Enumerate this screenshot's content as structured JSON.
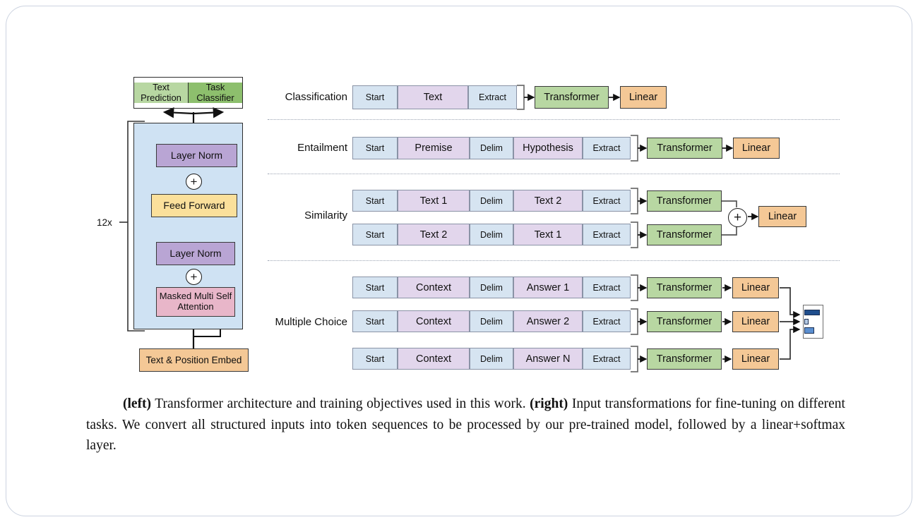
{
  "figure": {
    "left_panel": {
      "heads": [
        {
          "label": "Text Prediction",
          "color": "#b8d7a2"
        },
        {
          "label": "Task Classifier",
          "color": "#8dbf6d"
        }
      ],
      "repeat_label": "12x",
      "blocks": [
        {
          "name": "layer-norm-top",
          "label": "Layer Norm",
          "color": "#b9a5d4"
        },
        {
          "name": "feed-forward",
          "label": "Feed Forward",
          "color": "#fbe09b"
        },
        {
          "name": "layer-norm-bottom",
          "label": "Layer Norm",
          "color": "#b9a5d4"
        },
        {
          "name": "masked-multi-self-attention",
          "label": "Masked Multi Self Attention",
          "color": "#e8b6c9"
        }
      ],
      "embedding": {
        "label": "Text & Position Embed",
        "color": "#f4c896"
      },
      "block_background_color": "#cfe2f3",
      "add_symbol": "+"
    },
    "right_panel": {
      "transformer_label": "Transformer",
      "linear_label": "Linear",
      "add_symbol": "+",
      "tasks": [
        {
          "name": "classification",
          "label": "Classification",
          "sequences": [
            {
              "tokens": [
                "Start",
                "Text",
                "Extract"
              ]
            }
          ]
        },
        {
          "name": "entailment",
          "label": "Entailment",
          "sequences": [
            {
              "tokens": [
                "Start",
                "Premise",
                "Delim",
                "Hypothesis",
                "Extract"
              ]
            }
          ]
        },
        {
          "name": "similarity",
          "label": "Similarity",
          "sequences": [
            {
              "tokens": [
                "Start",
                "Text 1",
                "Delim",
                "Text 2",
                "Extract"
              ]
            },
            {
              "tokens": [
                "Start",
                "Text 2",
                "Delim",
                "Text 1",
                "Extract"
              ]
            }
          ]
        },
        {
          "name": "multiple-choice",
          "label": "Multiple Choice",
          "sequences": [
            {
              "tokens": [
                "Start",
                "Context",
                "Delim",
                "Answer 1",
                "Extract"
              ]
            },
            {
              "tokens": [
                "Start",
                "Context",
                "Delim",
                "Answer 2",
                "Extract"
              ]
            },
            {
              "tokens": [
                "Start",
                "Context",
                "Delim",
                "Answer N",
                "Extract"
              ]
            }
          ]
        }
      ]
    },
    "colors": {
      "token_start": "#d6e4f1",
      "token_mid": "#e2d6ec",
      "transformer": "#b8d7a2",
      "linear": "#f4c896",
      "output_bar_dark": "#1f4e8c",
      "output_bar_mid": "#5b8fd0",
      "output_bar_light": "#b6cbe5"
    }
  },
  "caption": {
    "part1_bold": "(left)",
    "part1_text": " Transformer architecture and training objectives used in this work. ",
    "part2_bold": "(right)",
    "part2_text": " Input transformations for fine-tuning on different tasks. We convert all structured inputs into token sequences to be processed by our pre-trained model, followed by a linear+softmax layer."
  }
}
